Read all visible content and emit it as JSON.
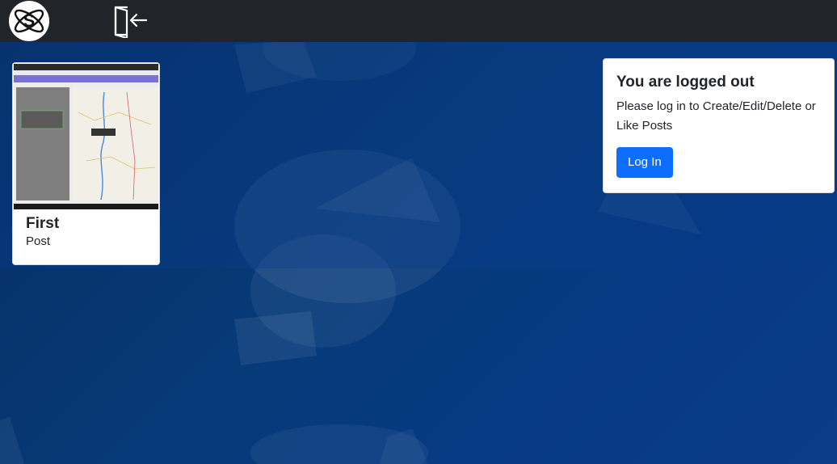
{
  "navbar": {
    "logo_letter": "S",
    "logo_icon": "atom-s-logo-icon",
    "logout_icon": "door-exit-icon"
  },
  "posts": [
    {
      "title": "First",
      "subtitle": "Post",
      "thumbnail_icon": "map-screenshot-thumbnail"
    }
  ],
  "auth": {
    "title": "You are logged out",
    "message": "Please log in to Create/Edit/Delete or Like Posts",
    "button_label": "Log In"
  },
  "colors": {
    "navbar": "#212529",
    "primary": "#0d6efd",
    "background": "#073a78"
  }
}
